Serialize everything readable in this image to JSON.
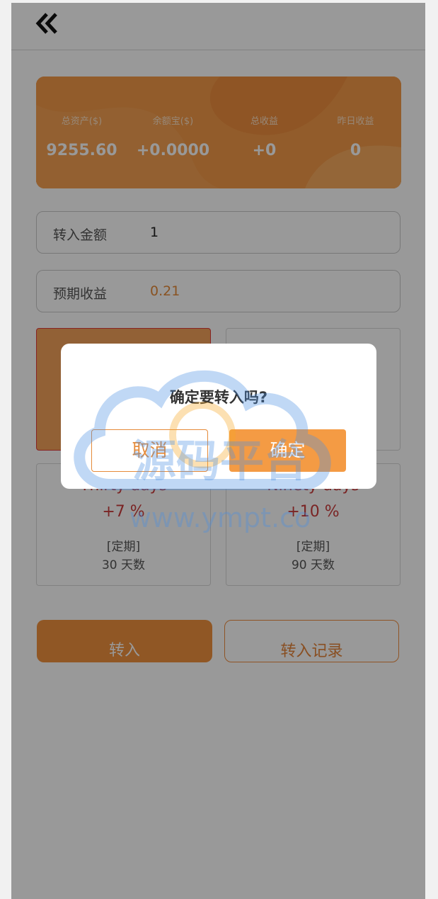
{
  "header": {
    "back_icon": "double-chevron-left-icon"
  },
  "stats": [
    {
      "label": "总资产($)",
      "value": "9255.60"
    },
    {
      "label": "余额宝($)",
      "value": "+0.0000"
    },
    {
      "label": "总收益",
      "value": "+0"
    },
    {
      "label": "昨日收益",
      "value": "0"
    }
  ],
  "form": {
    "amount_label": "转入金额",
    "amount_value": "1",
    "expected_label": "预期收益",
    "expected_value": "0.21"
  },
  "plans": [
    {
      "name": "",
      "rate": "",
      "type": "",
      "days": "",
      "selected": true
    },
    {
      "name": "",
      "rate": "",
      "type": "",
      "days": "",
      "selected": false
    },
    {
      "name": "Thirty days",
      "rate": "+7 %",
      "type": "[定期]",
      "days": "30 天数",
      "selected": false
    },
    {
      "name": "Ninety days",
      "rate": "+10 %",
      "type": "[定期]",
      "days": "90 天数",
      "selected": false
    }
  ],
  "buttons": {
    "transfer_in": "转入",
    "transfer_records": "转入记录"
  },
  "dialog": {
    "title": "确定要转入吗?",
    "cancel": "取消",
    "confirm": "确定"
  },
  "watermark": {
    "text_cn": "源码平台",
    "text_url": "www.ympt.co"
  },
  "colors": {
    "accent": "#f0923e",
    "rate_red": "#cc3d3d",
    "selected_border": "#e23b3b"
  }
}
